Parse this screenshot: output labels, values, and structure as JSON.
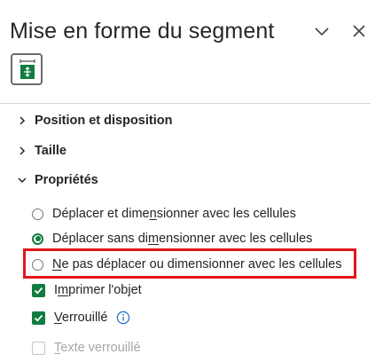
{
  "pane": {
    "title": "Mise en forme du segment",
    "collapse_icon": "chevron-down-icon",
    "close_icon": "close-icon",
    "tab_icon": "size-properties-icon"
  },
  "sections": {
    "position": "Position et disposition",
    "size": "Taille",
    "properties": "Propriétés"
  },
  "properties": {
    "radio_options": [
      {
        "pre": "Déplacer et dime",
        "ul": "n",
        "post": "sionner avec les cellules",
        "checked": false
      },
      {
        "pre": "Déplacer sans di",
        "ul": "m",
        "post": "ensionner avec les cellules",
        "checked": true
      },
      {
        "pre": "",
        "ul": "N",
        "post": "e pas déplacer ou dimensionner avec les cellules",
        "checked": false
      }
    ],
    "print": {
      "pre": "I",
      "ul": "m",
      "post": "primer l'objet",
      "checked": true
    },
    "locked": {
      "pre": "",
      "ul": "V",
      "post": "errouillé",
      "checked": true,
      "info_icon": "info-icon"
    },
    "lock_text": {
      "pre": "",
      "ul": "T",
      "post": "exte verrouillé",
      "checked": false,
      "disabled": true
    }
  },
  "colors": {
    "accent_green": "#107c41",
    "highlight_red": "#e3161c"
  }
}
